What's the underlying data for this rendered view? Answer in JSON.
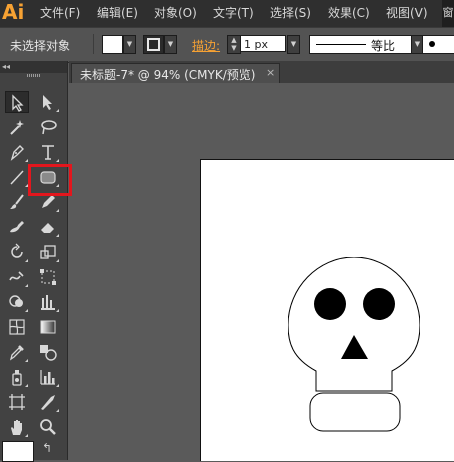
{
  "app": {
    "logo": "Ai",
    "name": "Adobe Illustrator"
  },
  "menu": [
    {
      "label": "文件(F)"
    },
    {
      "label": "编辑(E)"
    },
    {
      "label": "对象(O)"
    },
    {
      "label": "文字(T)"
    },
    {
      "label": "选择(S)"
    },
    {
      "label": "效果(C)"
    },
    {
      "label": "视图(V)"
    }
  ],
  "menu_overflow": "窗",
  "control_bar": {
    "selection_status": "未选择对象",
    "stroke_label": "描边:",
    "stroke_value": "1 px",
    "profile_label": "等比"
  },
  "document_tab": {
    "title": "未标题-7* @ 94% (CMYK/预览)",
    "close": "×"
  },
  "toolbar": {
    "tools": [
      {
        "name": "selection-tool"
      },
      {
        "name": "direct-selection-tool"
      },
      {
        "name": "magic-wand-tool"
      },
      {
        "name": "lasso-tool"
      },
      {
        "name": "pen-tool"
      },
      {
        "name": "type-tool"
      },
      {
        "name": "line-segment-tool"
      },
      {
        "name": "rounded-rectangle-tool"
      },
      {
        "name": "paintbrush-tool"
      },
      {
        "name": "pencil-tool"
      },
      {
        "name": "blob-brush-tool"
      },
      {
        "name": "eraser-tool"
      },
      {
        "name": "rotate-tool"
      },
      {
        "name": "scale-tool"
      },
      {
        "name": "warp-tool"
      },
      {
        "name": "free-transform-tool"
      },
      {
        "name": "shape-builder-tool"
      },
      {
        "name": "column-graph-tool"
      },
      {
        "name": "mesh-tool"
      },
      {
        "name": "gradient-tool"
      },
      {
        "name": "eyedropper-tool"
      },
      {
        "name": "blend-tool"
      },
      {
        "name": "symbol-sprayer-tool"
      },
      {
        "name": "graph-tool"
      },
      {
        "name": "artboard-tool"
      },
      {
        "name": "slice-tool"
      },
      {
        "name": "hand-tool"
      },
      {
        "name": "zoom-tool"
      }
    ],
    "highlighted_tool": "rounded-rectangle-tool",
    "highlight_color": "#e3161d"
  },
  "colors": {
    "logo": "#f7a233",
    "stroke_label": "#f7a233",
    "canvas_background": "#5a5a5a",
    "artboard": "#ffffff"
  }
}
